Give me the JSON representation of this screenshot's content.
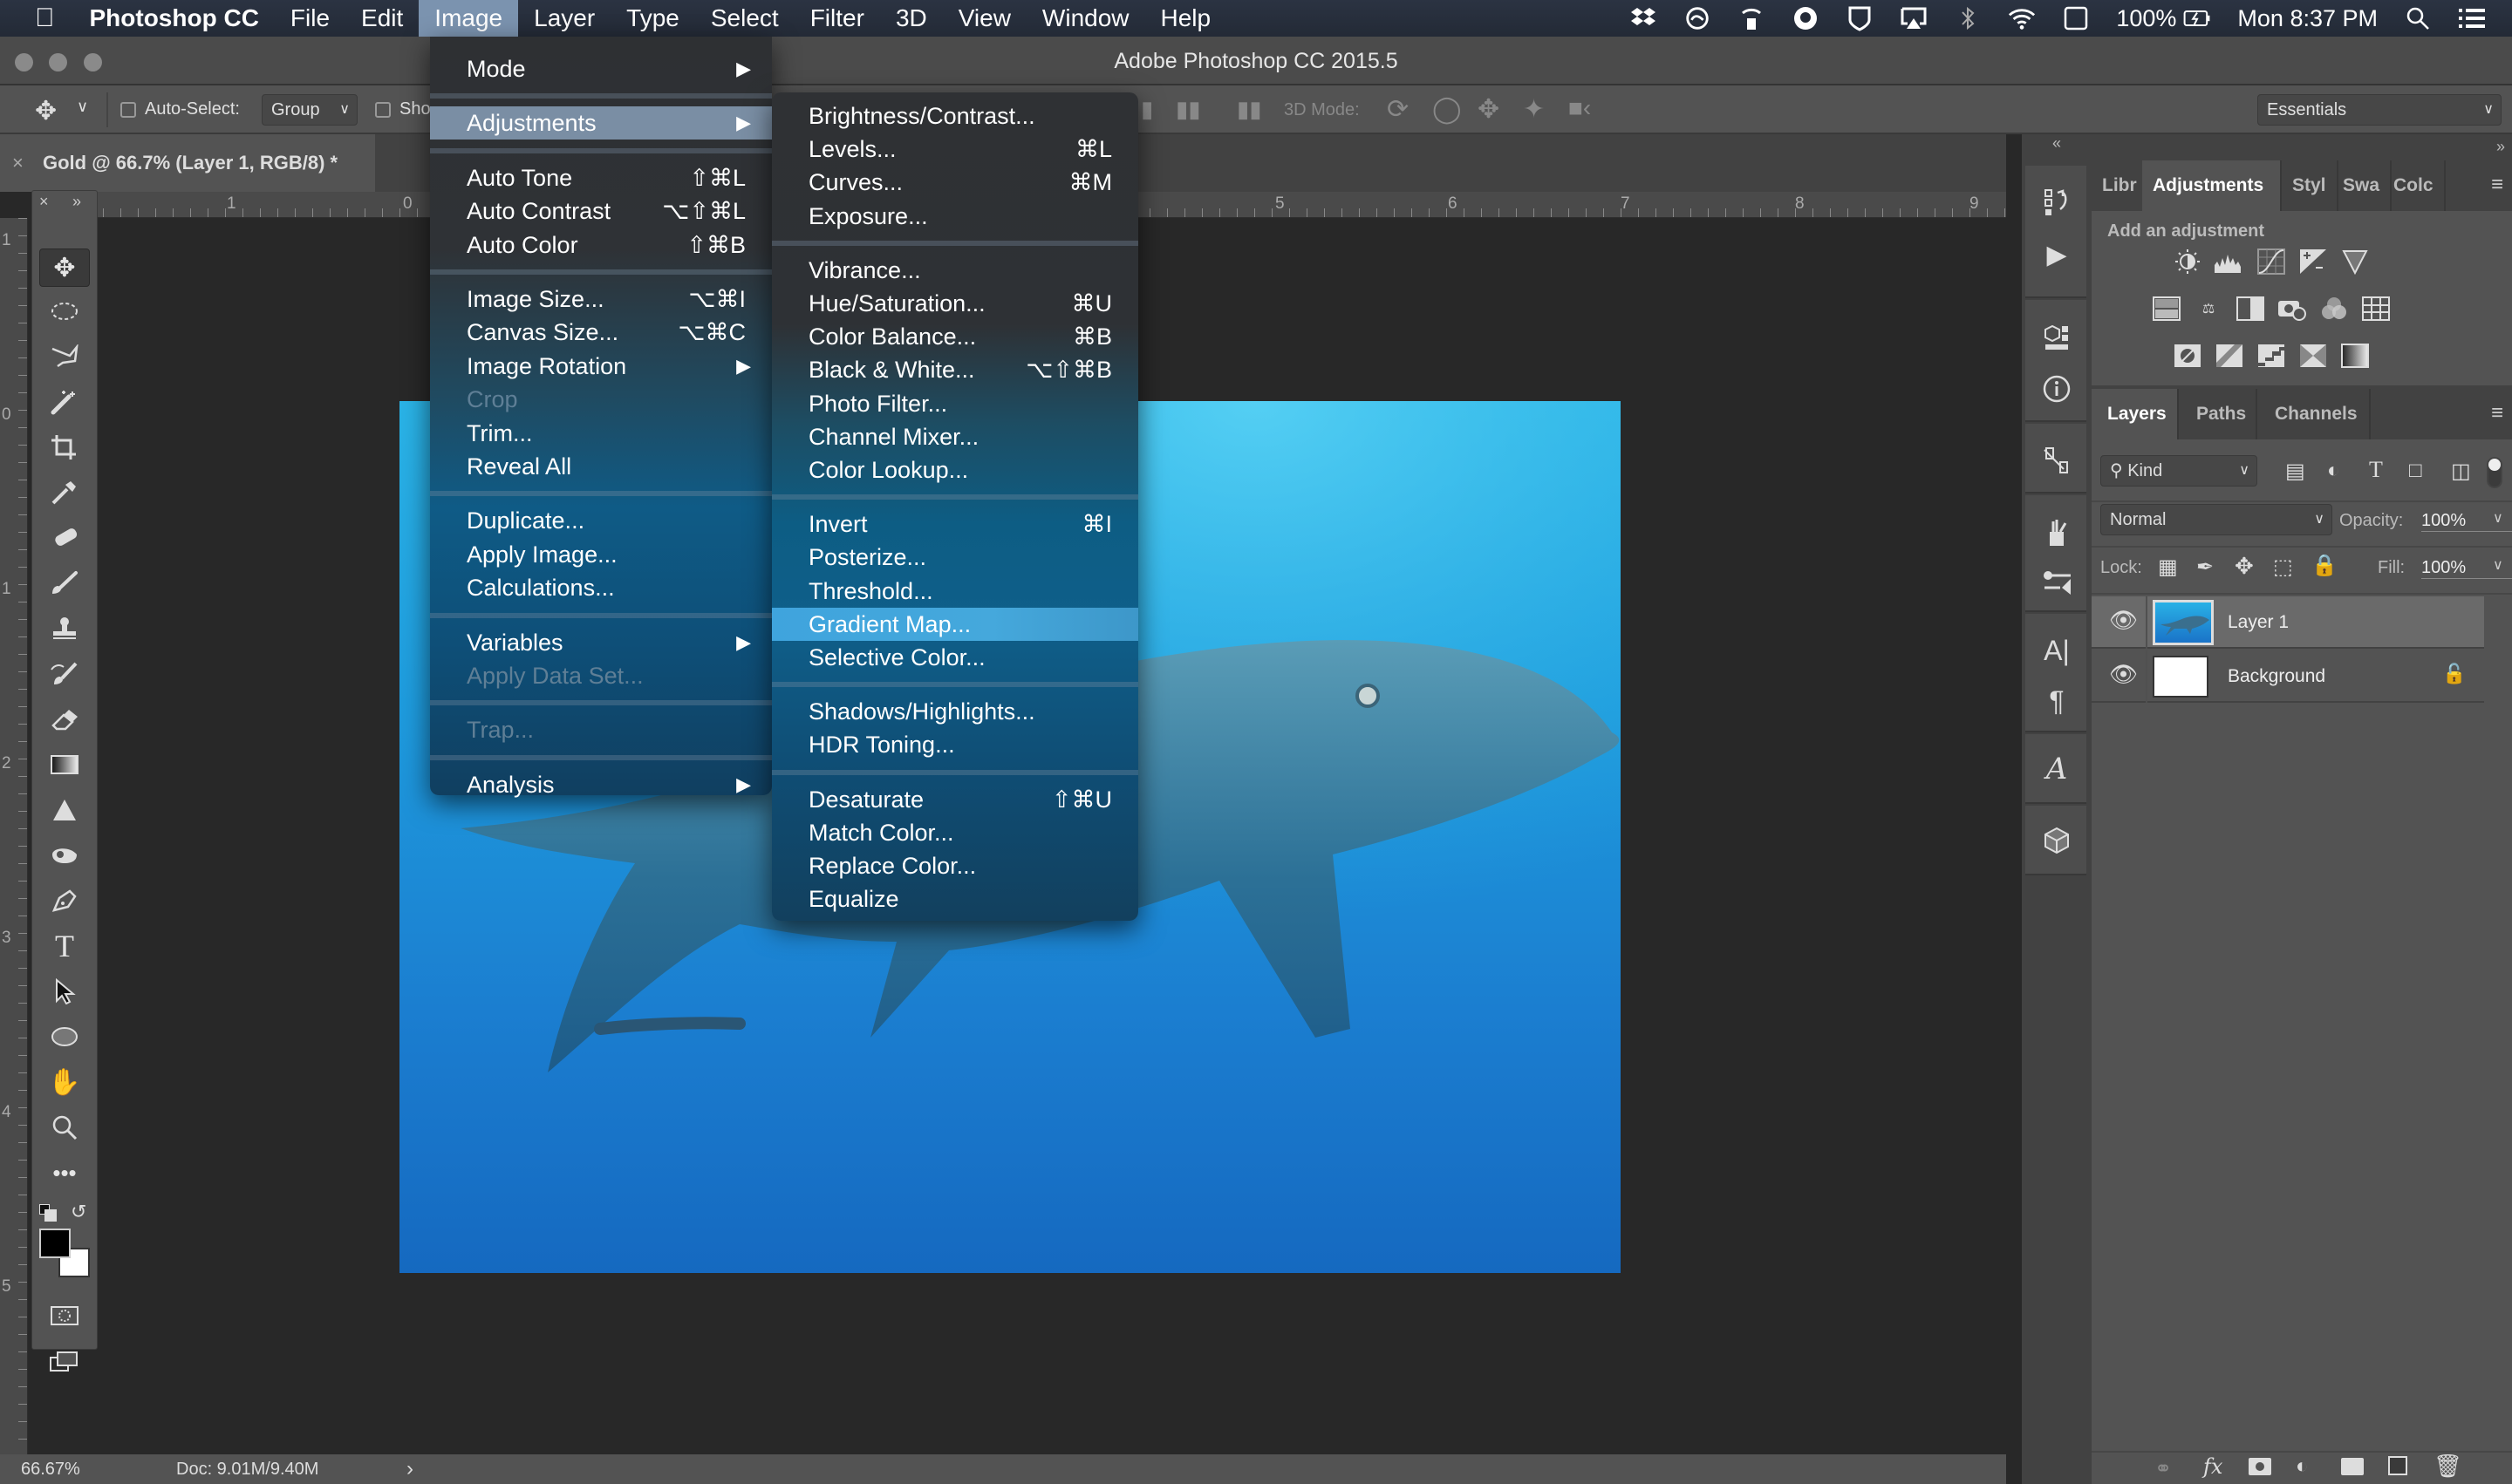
{
  "menubar": {
    "apple": "",
    "app_name": "Photoshop CC",
    "items": [
      "File",
      "Edit",
      "Image",
      "Layer",
      "Type",
      "Select",
      "Filter",
      "3D",
      "View",
      "Window",
      "Help"
    ],
    "active": "Image",
    "status": {
      "battery": "100%",
      "clock": "Mon 8:37 PM"
    }
  },
  "window": {
    "title": "Adobe Photoshop CC 2015.5"
  },
  "options_bar": {
    "auto_select_label": "Auto-Select:",
    "auto_select_value": "Group",
    "show_label": "Sho",
    "mode_3d_label": "3D Mode:",
    "workspace": "Essentials"
  },
  "document": {
    "tab_title": "Gold @ 66.7% (Layer 1, RGB/8) *",
    "zoom": "66.67%",
    "doc_size": "Doc: 9.01M/9.40M"
  },
  "rulers": {
    "h": [
      "1",
      "0",
      "5",
      "6",
      "7",
      "8",
      "9"
    ],
    "v": [
      "1",
      "0",
      "1",
      "2",
      "3",
      "4",
      "5"
    ]
  },
  "image_menu": {
    "items": [
      {
        "label": "Mode",
        "submenu": true
      },
      {
        "sep": true
      },
      {
        "label": "Adjustments",
        "submenu": true,
        "highlight": true
      },
      {
        "sep": true
      },
      {
        "label": "Auto Tone",
        "shortcut": "⇧⌘L"
      },
      {
        "label": "Auto Contrast",
        "shortcut": "⌥⇧⌘L"
      },
      {
        "label": "Auto Color",
        "shortcut": "⇧⌘B"
      },
      {
        "sep": true
      },
      {
        "label": "Image Size...",
        "shortcut": "⌥⌘I"
      },
      {
        "label": "Canvas Size...",
        "shortcut": "⌥⌘C"
      },
      {
        "label": "Image Rotation",
        "submenu": true
      },
      {
        "label": "Crop",
        "disabled": true
      },
      {
        "label": "Trim..."
      },
      {
        "label": "Reveal All"
      },
      {
        "sep": true
      },
      {
        "label": "Duplicate..."
      },
      {
        "label": "Apply Image..."
      },
      {
        "label": "Calculations..."
      },
      {
        "sep": true
      },
      {
        "label": "Variables",
        "submenu": true
      },
      {
        "label": "Apply Data Set...",
        "disabled": true
      },
      {
        "sep": true
      },
      {
        "label": "Trap...",
        "disabled": true
      },
      {
        "sep": true
      },
      {
        "label": "Analysis",
        "submenu": true
      }
    ]
  },
  "adjustments_menu": {
    "items": [
      {
        "label": "Brightness/Contrast..."
      },
      {
        "label": "Levels...",
        "shortcut": "⌘L"
      },
      {
        "label": "Curves...",
        "shortcut": "⌘M"
      },
      {
        "label": "Exposure..."
      },
      {
        "sep": true
      },
      {
        "label": "Vibrance..."
      },
      {
        "label": "Hue/Saturation...",
        "shortcut": "⌘U"
      },
      {
        "label": "Color Balance...",
        "shortcut": "⌘B"
      },
      {
        "label": "Black & White...",
        "shortcut": "⌥⇧⌘B"
      },
      {
        "label": "Photo Filter..."
      },
      {
        "label": "Channel Mixer..."
      },
      {
        "label": "Color Lookup..."
      },
      {
        "sep": true
      },
      {
        "label": "Invert",
        "shortcut": "⌘I"
      },
      {
        "label": "Posterize..."
      },
      {
        "label": "Threshold..."
      },
      {
        "label": "Gradient Map...",
        "highlight": true
      },
      {
        "label": "Selective Color..."
      },
      {
        "sep": true
      },
      {
        "label": "Shadows/Highlights..."
      },
      {
        "label": "HDR Toning..."
      },
      {
        "sep": true
      },
      {
        "label": "Desaturate",
        "shortcut": "⇧⌘U"
      },
      {
        "label": "Match Color..."
      },
      {
        "label": "Replace Color..."
      },
      {
        "label": "Equalize"
      }
    ]
  },
  "adjustments_panel": {
    "tabs": [
      "Libr",
      "Adjustments",
      "Styl",
      "Swa",
      "Colc"
    ],
    "active_tab": "Adjustments",
    "heading": "Add an adjustment"
  },
  "layers_panel": {
    "tabs": [
      "Layers",
      "Paths",
      "Channels"
    ],
    "active_tab": "Layers",
    "filter_label": "Kind",
    "blend_mode": "Normal",
    "opacity_label": "Opacity:",
    "opacity": "100%",
    "lock_label": "Lock:",
    "fill_label": "Fill:",
    "fill": "100%",
    "layers": [
      {
        "name": "Layer 1",
        "selected": true,
        "visible": true
      },
      {
        "name": "Background",
        "locked": true,
        "visible": true
      }
    ]
  },
  "colors": {
    "foreground": "#000000",
    "background": "#ffffff",
    "menu_highlight": "#45a8dc"
  }
}
